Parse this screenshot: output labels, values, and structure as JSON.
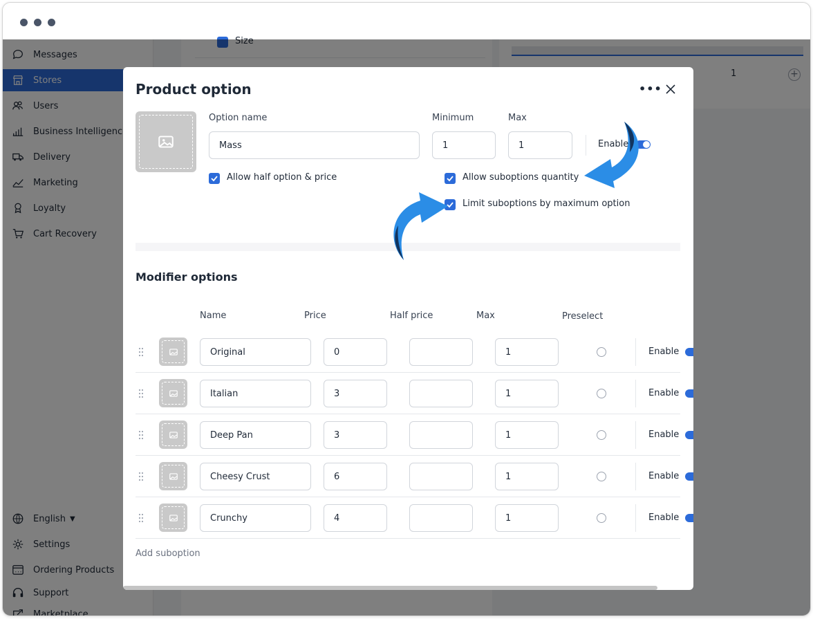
{
  "window": {},
  "sidebar": {
    "items": [
      {
        "label": "Messages",
        "icon": "chat-bubble-icon"
      },
      {
        "label": "Stores",
        "icon": "store-icon",
        "active": true
      },
      {
        "label": "Users",
        "icon": "users-icon"
      },
      {
        "label": "Business Intelligence",
        "icon": "bar-chart-icon"
      },
      {
        "label": "Delivery",
        "icon": "truck-icon"
      },
      {
        "label": "Marketing",
        "icon": "trend-line-icon"
      },
      {
        "label": "Loyalty",
        "icon": "medal-icon"
      },
      {
        "label": "Cart Recovery",
        "icon": "cart-icon"
      }
    ],
    "bottom_items": [
      {
        "label": "English",
        "icon": "globe-icon"
      },
      {
        "label": "Settings",
        "icon": "gear-icon"
      },
      {
        "label": "Ordering Products",
        "icon": "products-icon"
      },
      {
        "label": "Support",
        "icon": "headset-icon"
      },
      {
        "label": "Marketplace",
        "icon": "marketplace-icon"
      }
    ]
  },
  "background": {
    "size_label": "Size",
    "count_value": "1"
  },
  "modal": {
    "title": "Product option",
    "option_name_label": "Option name",
    "option_name_value": "Mass",
    "minimum_label": "Minimum",
    "minimum_value": "1",
    "max_label": "Max",
    "max_value": "1",
    "enable_label": "Enable",
    "checkboxes": {
      "allow_half": "Allow half option & price",
      "allow_suboptions_qty": "Allow suboptions quantity",
      "limit_suboptions": "Limit suboptions by maximum option"
    },
    "modifier_title": "Modifier options",
    "columns": {
      "name": "Name",
      "price": "Price",
      "half_price": "Half price",
      "max": "Max",
      "preselect": "Preselect"
    },
    "rows": [
      {
        "name": "Original",
        "price": "0",
        "half_price": "",
        "max": "1",
        "enable": "Enable"
      },
      {
        "name": "Italian",
        "price": "3",
        "half_price": "",
        "max": "1",
        "enable": "Enable"
      },
      {
        "name": "Deep Pan",
        "price": "3",
        "half_price": "",
        "max": "1",
        "enable": "Enable"
      },
      {
        "name": "Cheesy Crust",
        "price": "6",
        "half_price": "",
        "max": "1",
        "enable": "Enable"
      },
      {
        "name": "Crunchy",
        "price": "4",
        "half_price": "",
        "max": "1",
        "enable": "Enable"
      }
    ],
    "add_suboption": "Add suboption"
  },
  "colors": {
    "accent": "#2c6bd9",
    "annotation_arrow": "#2b8de6"
  }
}
